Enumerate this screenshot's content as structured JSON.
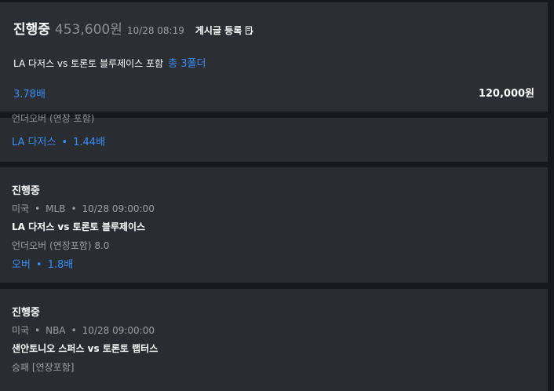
{
  "header": {
    "status": "진행중",
    "amount": "453,600원",
    "datetime": "10/28 08:19",
    "post_label": "게시글 등록",
    "match_text": "LA 다저스 vs 토론토 블루제이스 포함",
    "folder_text": "총 3폴더",
    "odds": "3.78배",
    "stake": "120,000원",
    "icon": "edit-document-icon"
  },
  "cards": [
    {
      "clipped_text": "언더오버 (연장 포함)",
      "pick": "LA 다저스",
      "pick_odds": "1.44배"
    },
    {
      "status": "진행중",
      "country": "미국",
      "league": "MLB",
      "datetime": "10/28 09:00:00",
      "match": "LA 다저스 vs 토론토 블루제이스",
      "market": "언더오버 (연장포함) 8.0",
      "pick": "오버",
      "pick_odds": "1.8배"
    },
    {
      "status": "진행중",
      "country": "미국",
      "league": "NBA",
      "datetime": "10/28 09:00:00",
      "match": "샌안토니오 스퍼스 vs 토론토 랩터스",
      "market": "승패 [연장포함]"
    }
  ],
  "colors": {
    "accent": "#3a8cf5",
    "panel": "#292d31",
    "background": "#16181b"
  }
}
